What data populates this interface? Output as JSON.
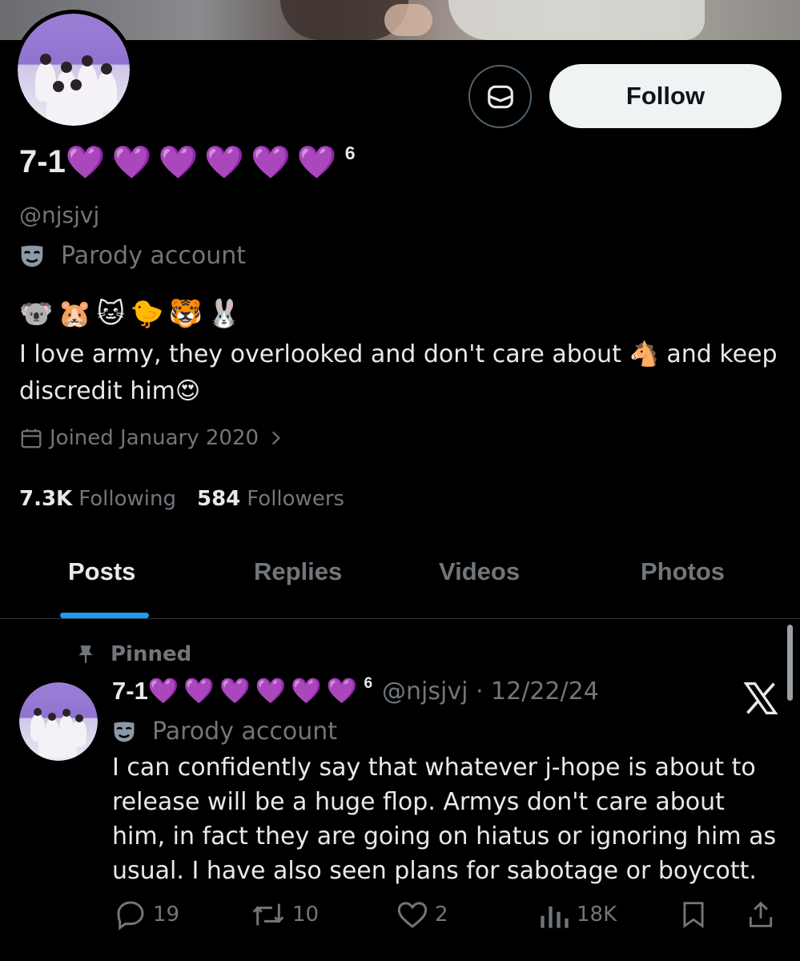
{
  "profile": {
    "name": "7-1",
    "heart_count_label": "6",
    "handle": "@njsjvj",
    "parody_label": "Parody account",
    "bio_emojis": "🐨🐹🐱🐤🐯🐰",
    "bio_text_before": "I love army, they overlooked and don't care about ",
    "bio_horse": "🐴",
    "bio_text_after": " and keep discredit him",
    "bio_emoji_end": "😍",
    "joined": "Joined January 2020",
    "following_count": "7.3K",
    "following_label": "Following",
    "followers_count": "584",
    "followers_label": "Followers",
    "heart": "💜"
  },
  "header": {
    "follow_label": "Follow"
  },
  "tabs": [
    {
      "label": "Posts",
      "active": true
    },
    {
      "label": "Replies",
      "active": false
    },
    {
      "label": "Videos",
      "active": false
    },
    {
      "label": "Photos",
      "active": false
    }
  ],
  "post": {
    "pinned_label": "Pinned",
    "name": "7-1",
    "heart_count_label": "6",
    "meta": "@njsjvj · 12/22/24",
    "parody_label": "Parody account",
    "text": "I can confidently say that whatever j-hope is about to release will be a huge flop. Armys don't care about him, in fact they are going on hiatus or ignoring him as usual. I have also seen plans for sabotage or boycott.",
    "replies": "19",
    "reposts": "10",
    "likes": "2",
    "views": "18K"
  },
  "colors": {
    "accent": "#1d9bf0",
    "muted": "#71767b",
    "text": "#e7e9ea",
    "background": "#000000"
  },
  "icons": [
    "message-icon",
    "mask-icon",
    "calendar-icon",
    "chevron-right-icon",
    "pin-icon",
    "x-logo-icon",
    "reply-icon",
    "repost-icon",
    "like-icon",
    "views-icon",
    "bookmark-icon",
    "share-icon"
  ]
}
